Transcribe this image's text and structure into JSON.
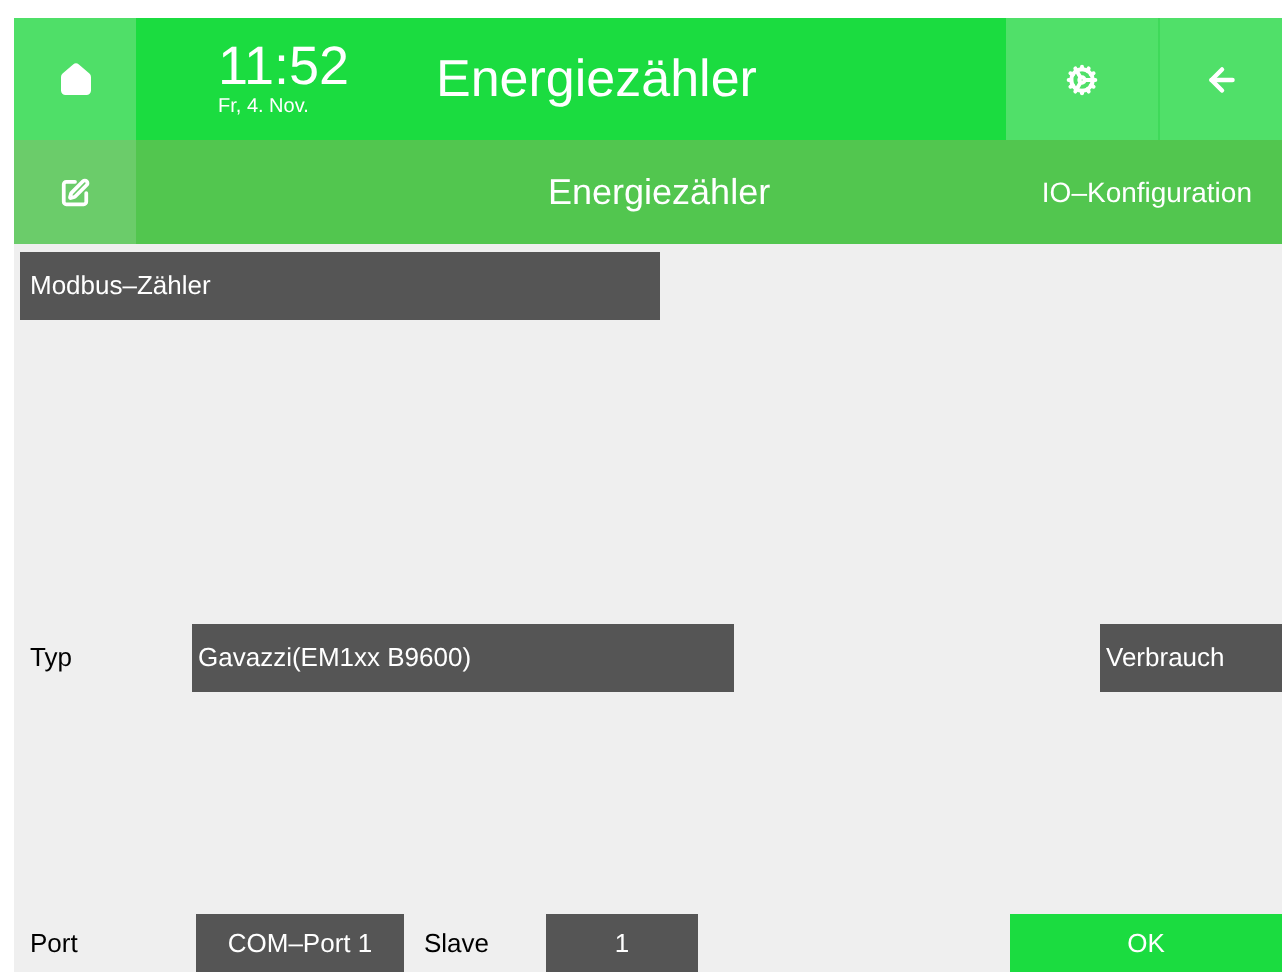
{
  "header": {
    "time": "11:52",
    "date": "Fr, 4. Nov.",
    "title": "Energiezähler"
  },
  "subheader": {
    "title": "Energiezähler",
    "section": "IO–Konfiguration"
  },
  "meter_button": "Modbus–Zähler",
  "type_row": {
    "label": "Typ",
    "value": "Gavazzi(EM1xx B9600)",
    "mode": "Verbrauch"
  },
  "port_row": {
    "port_label": "Port",
    "port_value": "COM–Port 1",
    "slave_label": "Slave",
    "slave_value": "1",
    "ok": "OK"
  }
}
